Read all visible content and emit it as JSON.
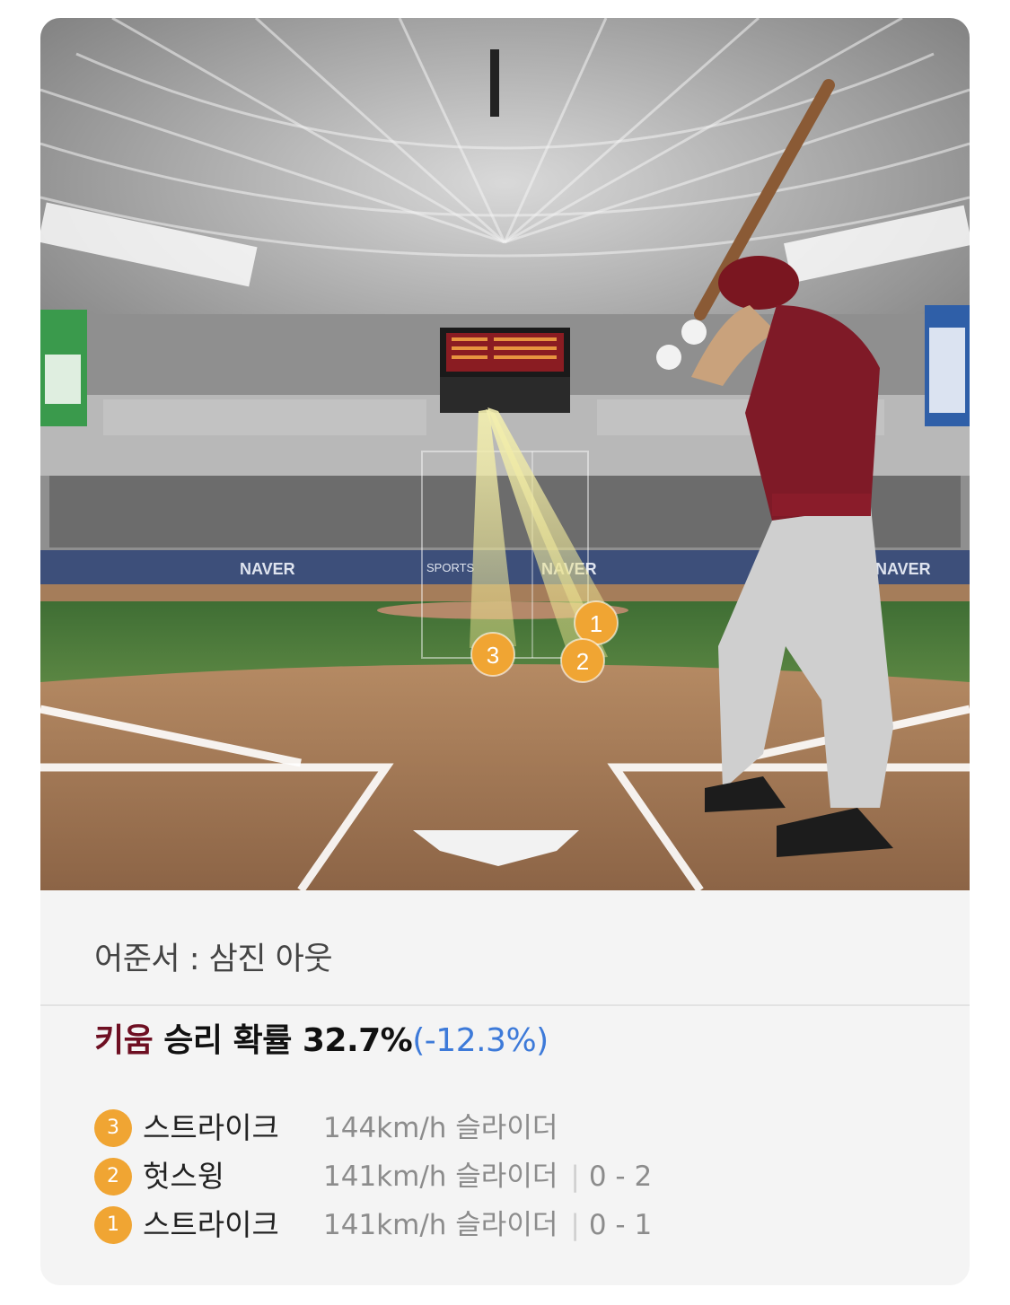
{
  "scene": {
    "wall_brand": "NAVER",
    "wall_brand_2": "SPORTS",
    "markers": [
      "1",
      "2",
      "3"
    ]
  },
  "result": {
    "text": "어준서 : 삼진 아웃"
  },
  "win_prob": {
    "team": "키움",
    "label": "승리 확률",
    "value": "32.7%",
    "delta": "(-12.3%)"
  },
  "pitches": [
    {
      "num": "3",
      "result": "스트라이크",
      "speed": "144km/h",
      "type": "슬라이더",
      "count": ""
    },
    {
      "num": "2",
      "result": "헛스윙",
      "speed": "141km/h",
      "type": "슬라이더",
      "count": "0 - 2"
    },
    {
      "num": "1",
      "result": "스트라이크",
      "speed": "141km/h",
      "type": "슬라이더",
      "count": "0 - 1"
    }
  ],
  "colors": {
    "team": "#6e0f22",
    "delta": "#3d7ad9",
    "badge": "#f0a533"
  }
}
